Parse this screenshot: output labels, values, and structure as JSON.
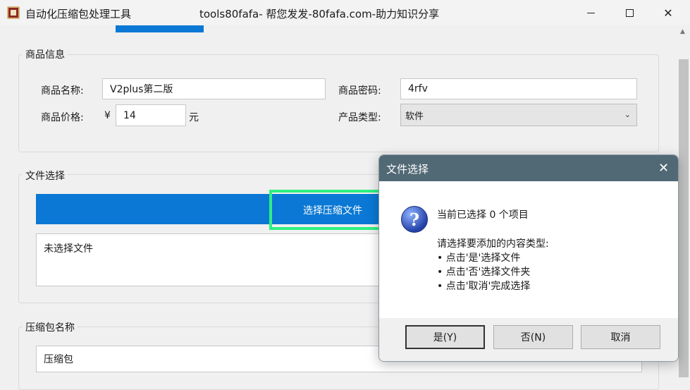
{
  "window": {
    "title": "自动化压缩包处理工具",
    "subtitle": "tools80fafa- 帮您发发-80fafa.com-助力知识分享",
    "close_glyph": "✕"
  },
  "product_info": {
    "group_title": "商品信息",
    "name_label": "商品名称:",
    "name_value": "V2plus第二版",
    "password_label": "商品密码:",
    "password_value": "4rfv",
    "price_label": "商品价格:",
    "currency_symbol": "¥",
    "price_value": "14",
    "price_unit": "元",
    "type_label": "产品类型:",
    "type_value": "软件"
  },
  "file_select": {
    "group_title": "文件选择",
    "choose_button": "选择压缩文件",
    "status_text": "未选择文件"
  },
  "archive_name": {
    "group_title": "压缩包名称",
    "value": "压缩包"
  },
  "dialog": {
    "title": "文件选择",
    "close_glyph": "✕",
    "icon_glyph": "?",
    "line1": "当前已选择 0 个项目",
    "line2": "请选择要添加的内容类型:",
    "line3": "• 点击'是'选择文件",
    "line4": "• 点击'否'选择文件夹",
    "line5": "• 点击'取消'完成选择",
    "yes_button": "是(Y)",
    "no_button": "否(N)",
    "cancel_button": "取消"
  },
  "colors": {
    "accent": "#0a78d4",
    "highlight": "#2ef081",
    "dialog_header": "#516875"
  }
}
